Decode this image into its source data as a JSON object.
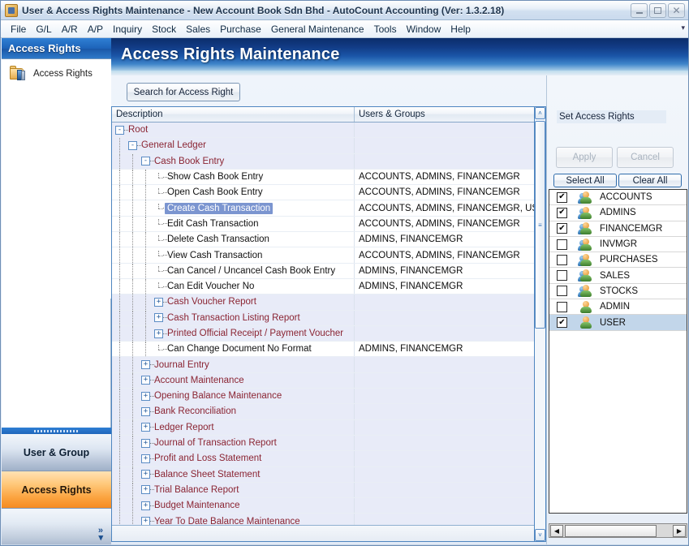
{
  "window": {
    "title": "User & Access Rights Maintenance - New Account Book Sdn Bhd - AutoCount Accounting (Ver: 1.3.2.18)",
    "icon": "app-icon",
    "buttons": {
      "minimize": "_",
      "maximize": "❐",
      "close": "✕"
    }
  },
  "menubar": {
    "overflow": "▾",
    "items": [
      {
        "label": "File"
      },
      {
        "label": "G/L"
      },
      {
        "label": "A/R"
      },
      {
        "label": "A/P"
      },
      {
        "label": "Inquiry"
      },
      {
        "label": "Stock"
      },
      {
        "label": "Sales"
      },
      {
        "label": "Purchase"
      },
      {
        "label": "General Maintenance"
      },
      {
        "label": "Tools"
      },
      {
        "label": "Window"
      },
      {
        "label": "Help"
      }
    ]
  },
  "sidebar": {
    "header": "Access Rights",
    "entry": {
      "label": "Access Rights",
      "icon": "folder-books-icon"
    },
    "nav_buttons": [
      {
        "label": "User & Group",
        "state": "normal"
      },
      {
        "label": "Access Rights",
        "state": "active"
      }
    ],
    "expand_chevron": "»"
  },
  "banner": {
    "title": "Access Rights Maintenance"
  },
  "toolbar": {
    "search_label": "Search for Access Right"
  },
  "tree": {
    "columns": [
      "Description",
      "Users & Groups"
    ],
    "scroll": {
      "up": "˄",
      "down": "˅",
      "grip": "≡"
    },
    "nodes": [
      {
        "depth": 0,
        "type": "group",
        "expander": "-",
        "label": "Root",
        "users": ""
      },
      {
        "depth": 1,
        "type": "group",
        "expander": "-",
        "label": "General Ledger",
        "users": ""
      },
      {
        "depth": 2,
        "type": "group",
        "expander": "-",
        "label": "Cash Book Entry",
        "users": ""
      },
      {
        "depth": 3,
        "type": "leaf",
        "expander": "",
        "label": "Show Cash Book Entry",
        "users": "ACCOUNTS, ADMINS, FINANCEMGR"
      },
      {
        "depth": 3,
        "type": "leaf",
        "expander": "",
        "label": "Open Cash Book Entry",
        "users": "ACCOUNTS, ADMINS, FINANCEMGR"
      },
      {
        "depth": 3,
        "type": "leaf",
        "expander": "",
        "label": "Create Cash Transaction",
        "users": "ACCOUNTS, ADMINS, FINANCEMGR, USER",
        "selected": true
      },
      {
        "depth": 3,
        "type": "leaf",
        "expander": "",
        "label": "Edit Cash Transaction",
        "users": "ACCOUNTS, ADMINS, FINANCEMGR"
      },
      {
        "depth": 3,
        "type": "leaf",
        "expander": "",
        "label": "Delete Cash Transaction",
        "users": "ADMINS, FINANCEMGR"
      },
      {
        "depth": 3,
        "type": "leaf",
        "expander": "",
        "label": "View Cash Transaction",
        "users": "ACCOUNTS, ADMINS, FINANCEMGR"
      },
      {
        "depth": 3,
        "type": "leaf",
        "expander": "",
        "label": "Can Cancel / Uncancel Cash Book Entry",
        "users": "ADMINS, FINANCEMGR"
      },
      {
        "depth": 3,
        "type": "leaf",
        "expander": "",
        "label": "Can Edit Voucher No",
        "users": "ADMINS, FINANCEMGR"
      },
      {
        "depth": 3,
        "type": "group",
        "expander": "+",
        "label": "Cash Voucher Report",
        "users": ""
      },
      {
        "depth": 3,
        "type": "group",
        "expander": "+",
        "label": "Cash Transaction Listing Report",
        "users": ""
      },
      {
        "depth": 3,
        "type": "group",
        "expander": "+",
        "label": "Printed Official Receipt / Payment Voucher",
        "users": ""
      },
      {
        "depth": 3,
        "type": "leaf",
        "expander": "",
        "label": "Can Change Document No Format",
        "users": "ADMINS, FINANCEMGR"
      },
      {
        "depth": 2,
        "type": "group",
        "expander": "+",
        "label": "Journal Entry",
        "users": ""
      },
      {
        "depth": 2,
        "type": "group",
        "expander": "+",
        "label": "Account Maintenance",
        "users": ""
      },
      {
        "depth": 2,
        "type": "group",
        "expander": "+",
        "label": "Opening Balance Maintenance",
        "users": ""
      },
      {
        "depth": 2,
        "type": "group",
        "expander": "+",
        "label": "Bank Reconciliation",
        "users": ""
      },
      {
        "depth": 2,
        "type": "group",
        "expander": "+",
        "label": "Ledger Report",
        "users": ""
      },
      {
        "depth": 2,
        "type": "group",
        "expander": "+",
        "label": "Journal of Transaction Report",
        "users": ""
      },
      {
        "depth": 2,
        "type": "group",
        "expander": "+",
        "label": "Profit and Loss Statement",
        "users": ""
      },
      {
        "depth": 2,
        "type": "group",
        "expander": "+",
        "label": "Balance Sheet Statement",
        "users": ""
      },
      {
        "depth": 2,
        "type": "group",
        "expander": "+",
        "label": "Trial Balance Report",
        "users": ""
      },
      {
        "depth": 2,
        "type": "group",
        "expander": "+",
        "label": "Budget Maintenance",
        "users": ""
      },
      {
        "depth": 2,
        "type": "group",
        "expander": "+",
        "label": "Year To Date Balance Maintenance",
        "users": ""
      }
    ]
  },
  "right_panel": {
    "set_access_rights_label": "Set Access Rights",
    "apply_label": "Apply",
    "cancel_label": "Cancel",
    "select_all_label": "Select All",
    "clear_all_label": "Clear All",
    "scroll": {
      "left": "◀",
      "right": "▶"
    },
    "check_glyph": "✔",
    "users": [
      {
        "name": "ACCOUNTS",
        "checked": true,
        "kind": "group",
        "selected": false
      },
      {
        "name": "ADMINS",
        "checked": true,
        "kind": "group",
        "selected": false
      },
      {
        "name": "FINANCEMGR",
        "checked": true,
        "kind": "group",
        "selected": false
      },
      {
        "name": "INVMGR",
        "checked": false,
        "kind": "group",
        "selected": false
      },
      {
        "name": "PURCHASES",
        "checked": false,
        "kind": "group",
        "selected": false
      },
      {
        "name": "SALES",
        "checked": false,
        "kind": "group",
        "selected": false
      },
      {
        "name": "STOCKS",
        "checked": false,
        "kind": "group",
        "selected": false
      },
      {
        "name": "ADMIN",
        "checked": false,
        "kind": "user",
        "selected": false
      },
      {
        "name": "USER",
        "checked": true,
        "kind": "user",
        "selected": true
      }
    ]
  },
  "colors": {
    "accent_blue": "#1a55a8",
    "active_orange": "#f58b22",
    "tree_group_text": "#8a2432",
    "selection_blue": "#7b95d0",
    "list_selection": "#c2d6ea"
  }
}
